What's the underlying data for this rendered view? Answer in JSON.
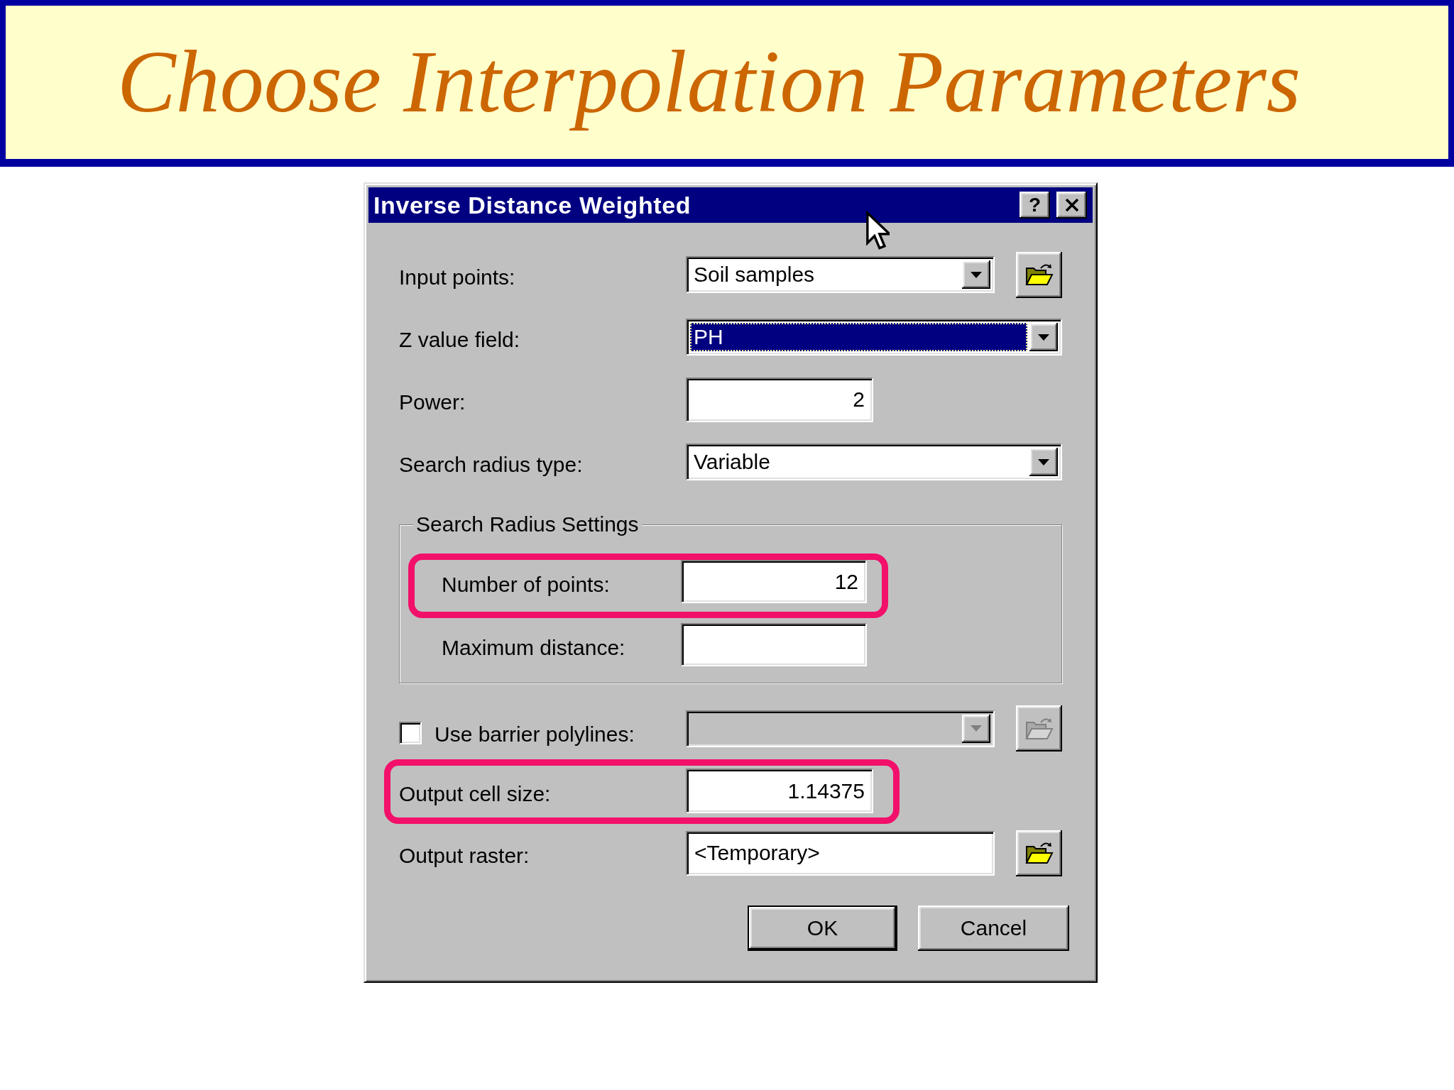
{
  "slide": {
    "title": "Choose Interpolation Parameters"
  },
  "dialog": {
    "title": "Inverse Distance Weighted",
    "help_button": "?",
    "fields": [
      {
        "kind": "combo",
        "label": "Input points:",
        "value": "Soil samples",
        "browse": true,
        "focused": false
      },
      {
        "kind": "combo",
        "label": "Z value field:",
        "value": "PH",
        "browse": false,
        "focused": true
      },
      {
        "kind": "number",
        "label": "Power:",
        "value": "2",
        "browse": false,
        "focused": false
      },
      {
        "kind": "combo",
        "label": "Search radius type:",
        "value": "Variable",
        "browse": false,
        "focused": false
      }
    ],
    "group": {
      "title": "Search Radius Settings",
      "fields": [
        {
          "kind": "number",
          "label": "Number of points:",
          "value": "12",
          "highlighted": true
        },
        {
          "kind": "number",
          "label": "Maximum distance:",
          "highlighted": false
        }
      ]
    },
    "barrier": {
      "label": "Use barrier polylines:",
      "checked": false,
      "disabled": true,
      "browse": true
    },
    "outputs": [
      {
        "kind": "number",
        "label": "Output cell size:",
        "value": "1.14375",
        "browse": false,
        "highlighted": true
      },
      {
        "kind": "text",
        "label": "Output raster:",
        "value": "<Temporary>",
        "browse": true,
        "highlighted": false
      }
    ],
    "buttons": [
      {
        "label": "OK",
        "default": true
      },
      {
        "label": "Cancel",
        "default": false
      }
    ]
  }
}
